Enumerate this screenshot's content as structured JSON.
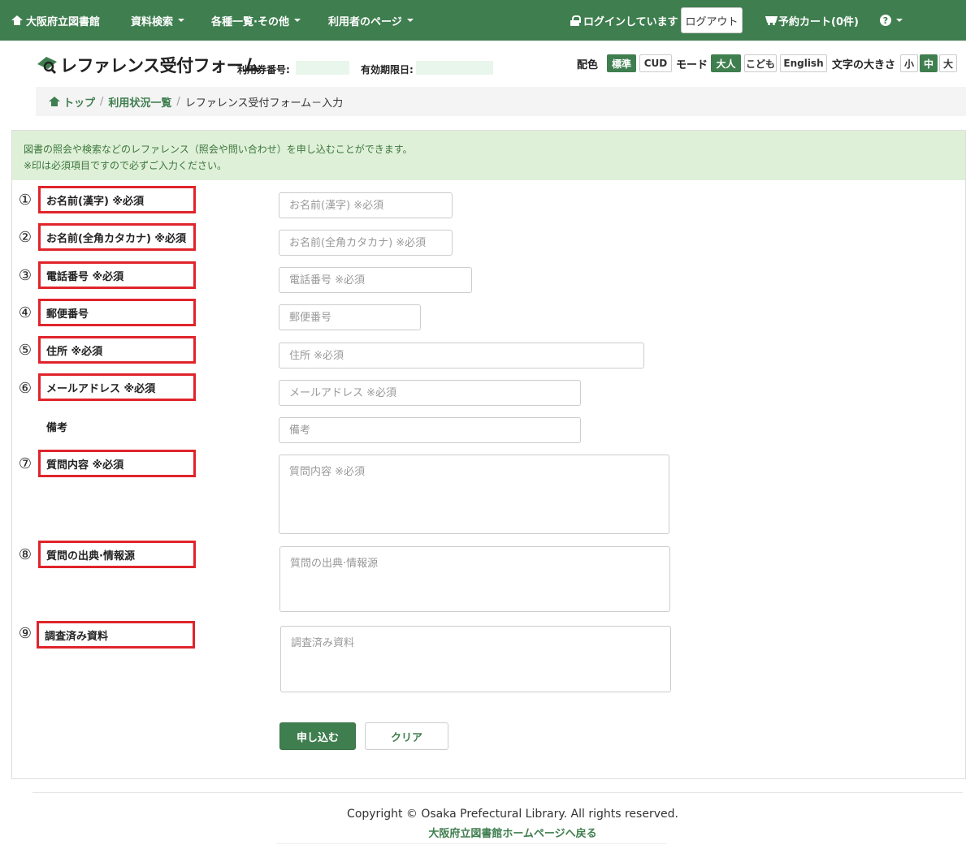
{
  "navbar": {
    "home_label": "大阪府立図書館",
    "search_label": "資料検索",
    "lists_label": "各種一覧·その他",
    "user_page_label": "利用者のページ",
    "login_status": "ログインしています",
    "logout_label": "ログアウト",
    "cart_label": "予約カート(0件)",
    "help_symbol": "?"
  },
  "header": {
    "title": "レファレンス受付フォーム",
    "card_number_label": "利用券番号:",
    "expiry_label": "有効期限日:",
    "color_label": "配色",
    "color_options": [
      "標準",
      "CUD"
    ],
    "mode_label": "モード",
    "mode_options": [
      "大人",
      "こども",
      "English"
    ],
    "font_size_label": "文字の大きさ",
    "font_size_options": [
      "小",
      "中",
      "大"
    ]
  },
  "breadcrumb": {
    "top": "トップ",
    "usage": "利用状況一覧",
    "current": "レファレンス受付フォーム－入力",
    "separator": "/"
  },
  "info": {
    "line1": "図書の照会や検索などのレファレンス（照会や問い合わせ）を申し込むことができます。",
    "line2": "※印は必須項目ですので必ずご入力ください。"
  },
  "form": {
    "fields": [
      {
        "num": "①",
        "label": "お名前(漢字) ※必須",
        "placeholder": "お名前(漢字) ※必須"
      },
      {
        "num": "②",
        "label": "お名前(全角カタカナ) ※必須",
        "placeholder": "お名前(全角カタカナ) ※必須"
      },
      {
        "num": "③",
        "label": "電話番号 ※必須",
        "placeholder": "電話番号 ※必須"
      },
      {
        "num": "④",
        "label": "郵便番号",
        "placeholder": "郵便番号"
      },
      {
        "num": "⑤",
        "label": "住所 ※必須",
        "placeholder": "住所 ※必須"
      },
      {
        "num": "⑥",
        "label": "メールアドレス ※必須",
        "placeholder": "メールアドレス ※必須"
      },
      {
        "num": "",
        "label": "備考",
        "placeholder": "備考"
      },
      {
        "num": "⑦",
        "label": "質問内容 ※必須",
        "placeholder": "質問内容 ※必須"
      },
      {
        "num": "⑧",
        "label": "質問の出典·情報源",
        "placeholder": "質問の出典·情報源"
      },
      {
        "num": "⑨",
        "label": "調査済み資料",
        "placeholder": "調査済み資料"
      }
    ],
    "submit_label": "申し込む",
    "clear_label": "クリア"
  },
  "footer": {
    "copyright": "Copyright © Osaka Prefectural Library. All rights reserved.",
    "home_link": "大阪府立図書館ホームページへ戻る"
  },
  "colors": {
    "brand_green": "#3f7e4f",
    "info_bg": "#dff0d8",
    "highlight_red": "#e0242b"
  }
}
